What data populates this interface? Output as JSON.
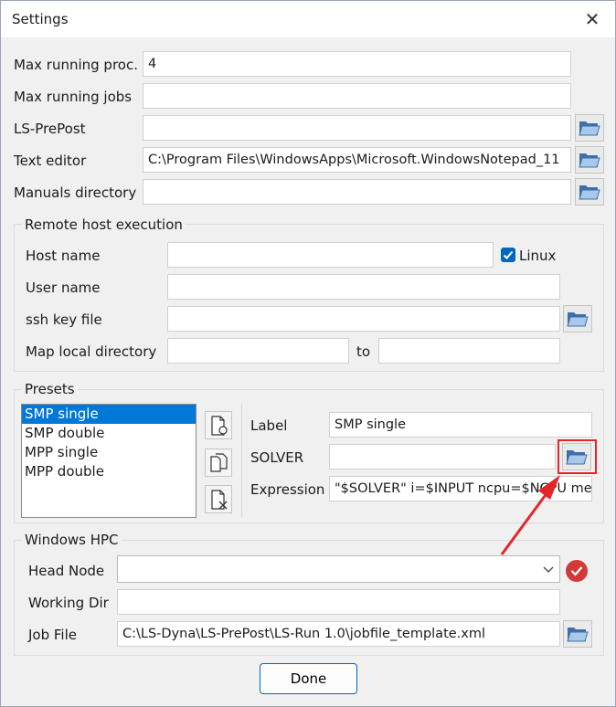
{
  "window": {
    "title": "Settings",
    "close_glyph": "✕"
  },
  "general": {
    "max_running_proc": {
      "label": "Max running proc.",
      "value": "4"
    },
    "max_running_jobs": {
      "label": "Max running jobs",
      "value": ""
    },
    "ls_prepost": {
      "label": "LS-PrePost",
      "value": ""
    },
    "text_editor": {
      "label": "Text editor",
      "value": "C:\\Program Files\\WindowsApps\\Microsoft.WindowsNotepad_11"
    },
    "manuals_directory": {
      "label": "Manuals directory",
      "value": ""
    }
  },
  "remote": {
    "title": "Remote host execution",
    "host_name": {
      "label": "Host name",
      "value": ""
    },
    "linux": {
      "label": "Linux",
      "checked": true
    },
    "user_name": {
      "label": "User name",
      "value": ""
    },
    "ssh_key_file": {
      "label": "ssh key file",
      "value": ""
    },
    "map_local_directory": {
      "label": "Map local directory",
      "value": "",
      "to_label": "to",
      "to_value": ""
    }
  },
  "presets": {
    "title": "Presets",
    "items": [
      {
        "label": "SMP single",
        "selected": true
      },
      {
        "label": "SMP double",
        "selected": false
      },
      {
        "label": "MPP single",
        "selected": false
      },
      {
        "label": "MPP double",
        "selected": false
      }
    ],
    "label_field": {
      "label": "Label",
      "value": "SMP single"
    },
    "solver_field": {
      "label": "SOLVER",
      "value": ""
    },
    "expression_field": {
      "label": "Expression",
      "value": "\"$SOLVER\" i=$INPUT ncpu=$NCPU me"
    }
  },
  "hpc": {
    "title": "Windows HPC",
    "head_node": {
      "label": "Head Node",
      "value": ""
    },
    "working_dir": {
      "label": "Working Dir",
      "value": ""
    },
    "job_file": {
      "label": "Job File",
      "value": "C:\\LS-Dyna\\LS-PrePost\\LS-Run 1.0\\jobfile_template.xml"
    }
  },
  "done_label": "Done",
  "icons": {
    "folder": "folder-open-icon",
    "check": "check-icon",
    "close": "close-icon"
  },
  "colors": {
    "accent": "#0067c0",
    "selection": "#0078d7",
    "annotation": "#e4262b",
    "status": "#d23a3a"
  }
}
